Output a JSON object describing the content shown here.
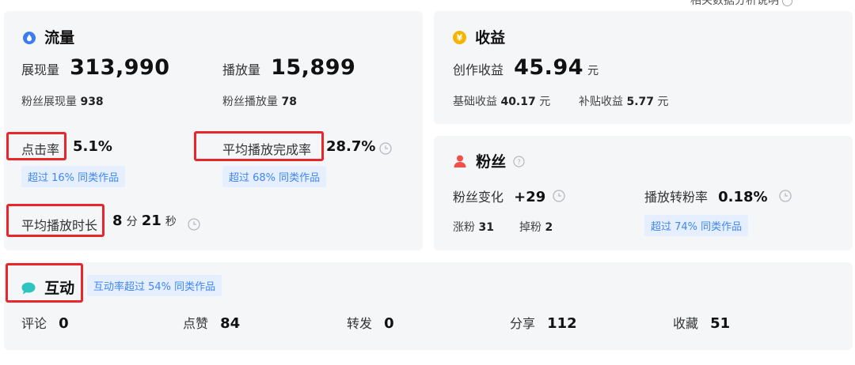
{
  "top_right": "相关数据分析说明",
  "flow": {
    "title": "流量",
    "impressions_label": "展现量",
    "impressions_value": "313,990",
    "plays_label": "播放量",
    "plays_value": "15,899",
    "fan_impressions_label": "粉丝展现量",
    "fan_impressions_value": "938",
    "fan_plays_label": "粉丝播放量",
    "fan_plays_value": "78",
    "ctr_label": "点击率",
    "ctr_value": "5.1%",
    "ctr_tag": "超过 16% 同类作品",
    "completion_label": "平均播放完成率",
    "completion_value": "28.7%",
    "completion_tag": "超过 68% 同类作品",
    "duration_label": "平均播放时长",
    "duration_min": "8",
    "duration_min_unit": "分",
    "duration_sec": "21",
    "duration_sec_unit": "秒"
  },
  "income": {
    "title": "收益",
    "creation_label": "创作收益",
    "creation_value": "45.94",
    "creation_unit": "元",
    "base_label": "基础收益",
    "base_value": "40.17",
    "base_unit": "元",
    "subsidy_label": "补贴收益",
    "subsidy_value": "5.77",
    "subsidy_unit": "元"
  },
  "fans": {
    "title": "粉丝",
    "change_label": "粉丝变化",
    "change_value": "+29",
    "conversion_label": "播放转粉率",
    "conversion_value": "0.18%",
    "gain_label": "涨粉",
    "gain_value": "31",
    "loss_label": "掉粉",
    "loss_value": "2",
    "conversion_tag": "超过 74% 同类作品"
  },
  "interaction": {
    "title": "互动",
    "tag": "互动率超过 54% 同类作品",
    "items": [
      {
        "label": "评论",
        "value": "0"
      },
      {
        "label": "点赞",
        "value": "84"
      },
      {
        "label": "转发",
        "value": "0"
      },
      {
        "label": "分享",
        "value": "112"
      },
      {
        "label": "收藏",
        "value": "51"
      }
    ]
  },
  "colors": {
    "highlight_border": "#e8262b",
    "tag_text": "#3f86f4",
    "tag_bg": "#e6efff",
    "card_bg": "#f5f6f8"
  }
}
